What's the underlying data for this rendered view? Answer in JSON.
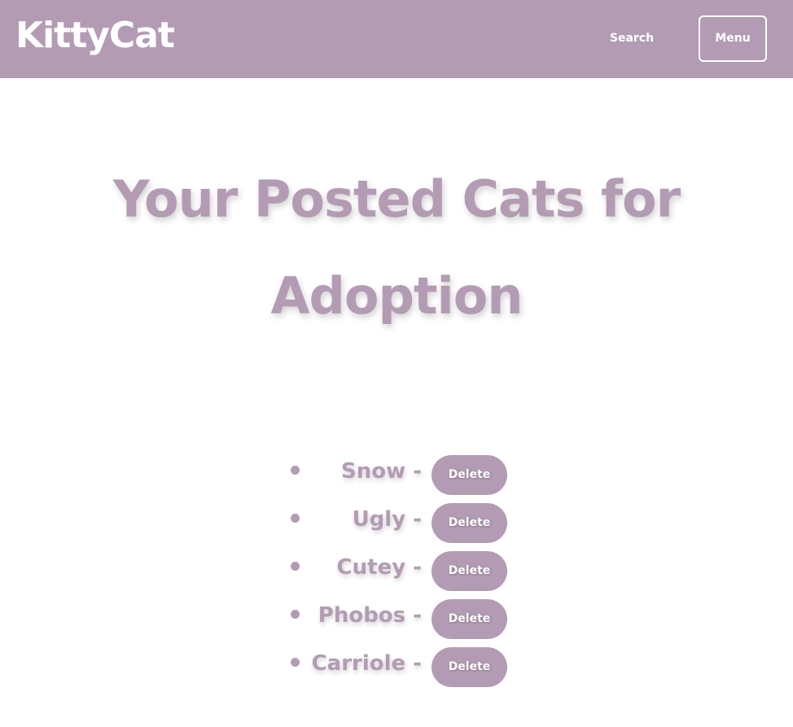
{
  "header": {
    "brand": "KittyCat",
    "search_label": "Search",
    "menu_label": "Menu"
  },
  "main": {
    "title": "Your Posted Cats for Adoption",
    "cats": [
      {
        "name": "Snow -",
        "delete_label": "Delete"
      },
      {
        "name": "Ugly -",
        "delete_label": "Delete"
      },
      {
        "name": "Cutey -",
        "delete_label": "Delete"
      },
      {
        "name": "Phobos -",
        "delete_label": "Delete"
      },
      {
        "name": "Carriole -",
        "delete_label": "Delete"
      }
    ]
  },
  "colors": {
    "brand": "#b39cb3",
    "text_on_brand": "#ffffff",
    "background": "#ffffff"
  }
}
